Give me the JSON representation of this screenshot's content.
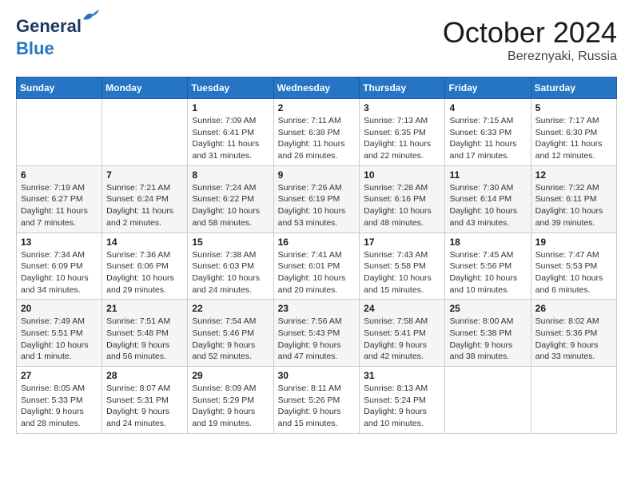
{
  "header": {
    "logo_line1": "General",
    "logo_line2": "Blue",
    "month": "October 2024",
    "location": "Bereznyaki, Russia"
  },
  "days_of_week": [
    "Sunday",
    "Monday",
    "Tuesday",
    "Wednesday",
    "Thursday",
    "Friday",
    "Saturday"
  ],
  "weeks": [
    [
      {
        "num": "",
        "sunrise": "",
        "sunset": "",
        "daylight": ""
      },
      {
        "num": "",
        "sunrise": "",
        "sunset": "",
        "daylight": ""
      },
      {
        "num": "1",
        "sunrise": "Sunrise: 7:09 AM",
        "sunset": "Sunset: 6:41 PM",
        "daylight": "Daylight: 11 hours and 31 minutes."
      },
      {
        "num": "2",
        "sunrise": "Sunrise: 7:11 AM",
        "sunset": "Sunset: 6:38 PM",
        "daylight": "Daylight: 11 hours and 26 minutes."
      },
      {
        "num": "3",
        "sunrise": "Sunrise: 7:13 AM",
        "sunset": "Sunset: 6:35 PM",
        "daylight": "Daylight: 11 hours and 22 minutes."
      },
      {
        "num": "4",
        "sunrise": "Sunrise: 7:15 AM",
        "sunset": "Sunset: 6:33 PM",
        "daylight": "Daylight: 11 hours and 17 minutes."
      },
      {
        "num": "5",
        "sunrise": "Sunrise: 7:17 AM",
        "sunset": "Sunset: 6:30 PM",
        "daylight": "Daylight: 11 hours and 12 minutes."
      }
    ],
    [
      {
        "num": "6",
        "sunrise": "Sunrise: 7:19 AM",
        "sunset": "Sunset: 6:27 PM",
        "daylight": "Daylight: 11 hours and 7 minutes."
      },
      {
        "num": "7",
        "sunrise": "Sunrise: 7:21 AM",
        "sunset": "Sunset: 6:24 PM",
        "daylight": "Daylight: 11 hours and 2 minutes."
      },
      {
        "num": "8",
        "sunrise": "Sunrise: 7:24 AM",
        "sunset": "Sunset: 6:22 PM",
        "daylight": "Daylight: 10 hours and 58 minutes."
      },
      {
        "num": "9",
        "sunrise": "Sunrise: 7:26 AM",
        "sunset": "Sunset: 6:19 PM",
        "daylight": "Daylight: 10 hours and 53 minutes."
      },
      {
        "num": "10",
        "sunrise": "Sunrise: 7:28 AM",
        "sunset": "Sunset: 6:16 PM",
        "daylight": "Daylight: 10 hours and 48 minutes."
      },
      {
        "num": "11",
        "sunrise": "Sunrise: 7:30 AM",
        "sunset": "Sunset: 6:14 PM",
        "daylight": "Daylight: 10 hours and 43 minutes."
      },
      {
        "num": "12",
        "sunrise": "Sunrise: 7:32 AM",
        "sunset": "Sunset: 6:11 PM",
        "daylight": "Daylight: 10 hours and 39 minutes."
      }
    ],
    [
      {
        "num": "13",
        "sunrise": "Sunrise: 7:34 AM",
        "sunset": "Sunset: 6:09 PM",
        "daylight": "Daylight: 10 hours and 34 minutes."
      },
      {
        "num": "14",
        "sunrise": "Sunrise: 7:36 AM",
        "sunset": "Sunset: 6:06 PM",
        "daylight": "Daylight: 10 hours and 29 minutes."
      },
      {
        "num": "15",
        "sunrise": "Sunrise: 7:38 AM",
        "sunset": "Sunset: 6:03 PM",
        "daylight": "Daylight: 10 hours and 24 minutes."
      },
      {
        "num": "16",
        "sunrise": "Sunrise: 7:41 AM",
        "sunset": "Sunset: 6:01 PM",
        "daylight": "Daylight: 10 hours and 20 minutes."
      },
      {
        "num": "17",
        "sunrise": "Sunrise: 7:43 AM",
        "sunset": "Sunset: 5:58 PM",
        "daylight": "Daylight: 10 hours and 15 minutes."
      },
      {
        "num": "18",
        "sunrise": "Sunrise: 7:45 AM",
        "sunset": "Sunset: 5:56 PM",
        "daylight": "Daylight: 10 hours and 10 minutes."
      },
      {
        "num": "19",
        "sunrise": "Sunrise: 7:47 AM",
        "sunset": "Sunset: 5:53 PM",
        "daylight": "Daylight: 10 hours and 6 minutes."
      }
    ],
    [
      {
        "num": "20",
        "sunrise": "Sunrise: 7:49 AM",
        "sunset": "Sunset: 5:51 PM",
        "daylight": "Daylight: 10 hours and 1 minute."
      },
      {
        "num": "21",
        "sunrise": "Sunrise: 7:51 AM",
        "sunset": "Sunset: 5:48 PM",
        "daylight": "Daylight: 9 hours and 56 minutes."
      },
      {
        "num": "22",
        "sunrise": "Sunrise: 7:54 AM",
        "sunset": "Sunset: 5:46 PM",
        "daylight": "Daylight: 9 hours and 52 minutes."
      },
      {
        "num": "23",
        "sunrise": "Sunrise: 7:56 AM",
        "sunset": "Sunset: 5:43 PM",
        "daylight": "Daylight: 9 hours and 47 minutes."
      },
      {
        "num": "24",
        "sunrise": "Sunrise: 7:58 AM",
        "sunset": "Sunset: 5:41 PM",
        "daylight": "Daylight: 9 hours and 42 minutes."
      },
      {
        "num": "25",
        "sunrise": "Sunrise: 8:00 AM",
        "sunset": "Sunset: 5:38 PM",
        "daylight": "Daylight: 9 hours and 38 minutes."
      },
      {
        "num": "26",
        "sunrise": "Sunrise: 8:02 AM",
        "sunset": "Sunset: 5:36 PM",
        "daylight": "Daylight: 9 hours and 33 minutes."
      }
    ],
    [
      {
        "num": "27",
        "sunrise": "Sunrise: 8:05 AM",
        "sunset": "Sunset: 5:33 PM",
        "daylight": "Daylight: 9 hours and 28 minutes."
      },
      {
        "num": "28",
        "sunrise": "Sunrise: 8:07 AM",
        "sunset": "Sunset: 5:31 PM",
        "daylight": "Daylight: 9 hours and 24 minutes."
      },
      {
        "num": "29",
        "sunrise": "Sunrise: 8:09 AM",
        "sunset": "Sunset: 5:29 PM",
        "daylight": "Daylight: 9 hours and 19 minutes."
      },
      {
        "num": "30",
        "sunrise": "Sunrise: 8:11 AM",
        "sunset": "Sunset: 5:26 PM",
        "daylight": "Daylight: 9 hours and 15 minutes."
      },
      {
        "num": "31",
        "sunrise": "Sunrise: 8:13 AM",
        "sunset": "Sunset: 5:24 PM",
        "daylight": "Daylight: 9 hours and 10 minutes."
      },
      {
        "num": "",
        "sunrise": "",
        "sunset": "",
        "daylight": ""
      },
      {
        "num": "",
        "sunrise": "",
        "sunset": "",
        "daylight": ""
      }
    ]
  ]
}
